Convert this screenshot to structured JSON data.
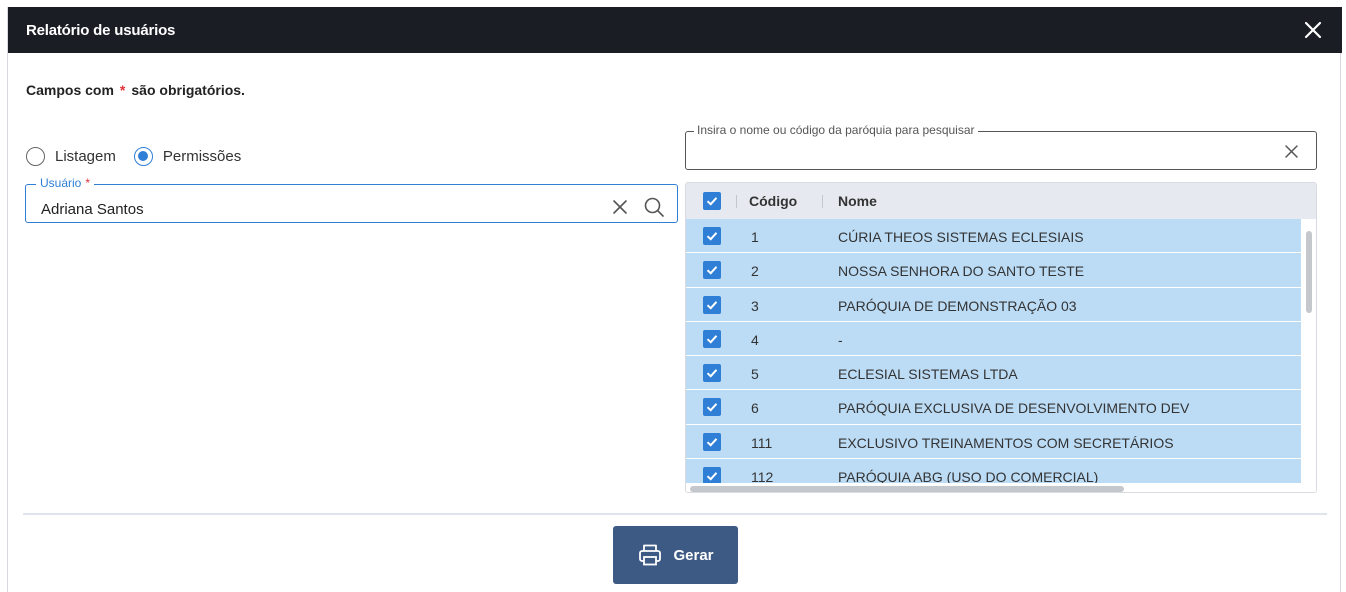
{
  "dialog": {
    "title": "Relatório de usuários",
    "close_icon": "close-icon"
  },
  "form": {
    "required_note_prefix": "Campos com",
    "required_star": "*",
    "required_note_suffix": "são obrigatórios.",
    "report_type_options": [
      {
        "label": "Listagem",
        "selected": false
      },
      {
        "label": "Permissões",
        "selected": true
      }
    ],
    "user_field": {
      "label": "Usuário",
      "required_star": "*",
      "value": "Adriana Santos",
      "clear_icon": "close-icon",
      "search_icon": "search-icon"
    },
    "parish_search": {
      "label": "Insira o nome ou código da paróquia para pesquisar",
      "value": "",
      "clear_icon": "close-icon"
    }
  },
  "grid": {
    "columns": {
      "code": "Código",
      "name": "Nome"
    },
    "rows": [
      {
        "code": "1",
        "name": "CÚRIA THEOS SISTEMAS ECLESIAIS",
        "checked": true
      },
      {
        "code": "2",
        "name": "NOSSA SENHORA DO SANTO TESTE",
        "checked": true
      },
      {
        "code": "3",
        "name": "PARÓQUIA DE DEMONSTRAÇÃO 03",
        "checked": true
      },
      {
        "code": "4",
        "name": "-",
        "checked": true
      },
      {
        "code": "5",
        "name": "ECLESIAL SISTEMAS LTDA",
        "checked": true
      },
      {
        "code": "6",
        "name": "PARÓQUIA EXCLUSIVA DE DESENVOLVIMENTO DEV",
        "checked": true
      },
      {
        "code": "111",
        "name": "EXCLUSIVO TREINAMENTOS COM SECRETÁRIOS",
        "checked": true
      },
      {
        "code": "112",
        "name": "PARÓQUIA ABG (USO DO COMERCIAL)",
        "checked": true
      }
    ],
    "header_checked": true
  },
  "actions": {
    "generate_label": "Gerar",
    "generate_icon": "printer-icon"
  },
  "colors": {
    "titlebar": "#1a1d24",
    "accent": "#2f7fd7",
    "row_selected": "#bcdcf6",
    "button": "#3d5a84",
    "required": "#e0303a"
  }
}
